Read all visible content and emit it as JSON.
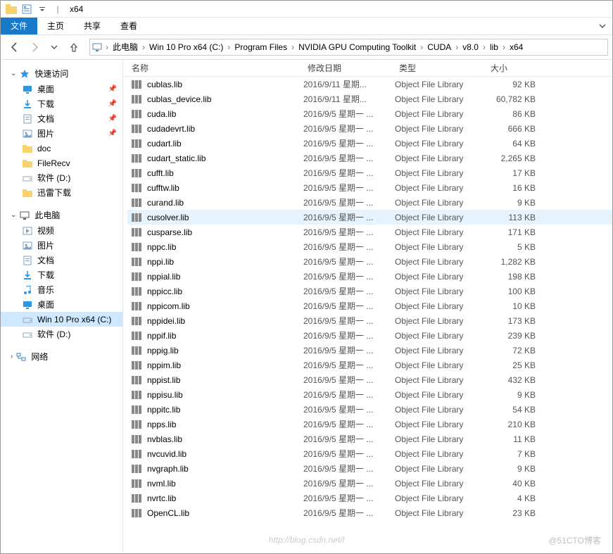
{
  "title": "x64",
  "ribbon": {
    "file": "文件",
    "home": "主页",
    "share": "共享",
    "view": "查看"
  },
  "breadcrumb": [
    "此电脑",
    "Win 10 Pro x64 (C:)",
    "Program Files",
    "NVIDIA GPU Computing Toolkit",
    "CUDA",
    "v8.0",
    "lib",
    "x64"
  ],
  "sidebar": {
    "quick": {
      "title": "快速访问",
      "items": [
        {
          "label": "桌面",
          "icon": "desktop",
          "pin": true,
          "color": "#2997e5"
        },
        {
          "label": "下载",
          "icon": "download",
          "pin": true,
          "color": "#2997e5"
        },
        {
          "label": "文档",
          "icon": "doc",
          "pin": true,
          "color": "#7aa0c4"
        },
        {
          "label": "图片",
          "icon": "picture",
          "pin": true,
          "color": "#7aa0c4"
        },
        {
          "label": "doc",
          "icon": "folder",
          "pin": false,
          "color": "#f8d36b"
        },
        {
          "label": "FileRecv",
          "icon": "folder",
          "pin": false,
          "color": "#f8d36b"
        },
        {
          "label": "软件 (D:)",
          "icon": "drive",
          "pin": false,
          "color": "#9aa7b0"
        },
        {
          "label": "迅雷下载",
          "icon": "folder",
          "pin": false,
          "color": "#f8d36b"
        }
      ]
    },
    "pc": {
      "title": "此电脑",
      "items": [
        {
          "label": "视频",
          "icon": "video",
          "color": "#7aa0c4"
        },
        {
          "label": "图片",
          "icon": "picture",
          "color": "#7aa0c4"
        },
        {
          "label": "文档",
          "icon": "doc",
          "color": "#7aa0c4"
        },
        {
          "label": "下载",
          "icon": "download",
          "color": "#2997e5"
        },
        {
          "label": "音乐",
          "icon": "music",
          "color": "#2997e5"
        },
        {
          "label": "桌面",
          "icon": "desktop",
          "color": "#2997e5"
        },
        {
          "label": "Win 10 Pro x64 (C:)",
          "icon": "drive",
          "color": "#9aa7b0",
          "selected": true
        },
        {
          "label": "软件 (D:)",
          "icon": "drive",
          "color": "#9aa7b0"
        }
      ]
    },
    "net": {
      "title": "网络"
    }
  },
  "columns": {
    "name": "名称",
    "date": "修改日期",
    "type": "类型",
    "size": "大小"
  },
  "files": [
    {
      "name": "cublas.lib",
      "date": "2016/9/11 星期...",
      "type": "Object File Library",
      "size": "92 KB"
    },
    {
      "name": "cublas_device.lib",
      "date": "2016/9/11 星期...",
      "type": "Object File Library",
      "size": "60,782 KB"
    },
    {
      "name": "cuda.lib",
      "date": "2016/9/5 星期一 ...",
      "type": "Object File Library",
      "size": "86 KB"
    },
    {
      "name": "cudadevrt.lib",
      "date": "2016/9/5 星期一 ...",
      "type": "Object File Library",
      "size": "666 KB"
    },
    {
      "name": "cudart.lib",
      "date": "2016/9/5 星期一 ...",
      "type": "Object File Library",
      "size": "64 KB"
    },
    {
      "name": "cudart_static.lib",
      "date": "2016/9/5 星期一 ...",
      "type": "Object File Library",
      "size": "2,265 KB"
    },
    {
      "name": "cufft.lib",
      "date": "2016/9/5 星期一 ...",
      "type": "Object File Library",
      "size": "17 KB"
    },
    {
      "name": "cufftw.lib",
      "date": "2016/9/5 星期一 ...",
      "type": "Object File Library",
      "size": "16 KB"
    },
    {
      "name": "curand.lib",
      "date": "2016/9/5 星期一 ...",
      "type": "Object File Library",
      "size": "9 KB"
    },
    {
      "name": "cusolver.lib",
      "date": "2016/9/5 星期一 ...",
      "type": "Object File Library",
      "size": "113 KB",
      "selected": true
    },
    {
      "name": "cusparse.lib",
      "date": "2016/9/5 星期一 ...",
      "type": "Object File Library",
      "size": "171 KB"
    },
    {
      "name": "nppc.lib",
      "date": "2016/9/5 星期一 ...",
      "type": "Object File Library",
      "size": "5 KB"
    },
    {
      "name": "nppi.lib",
      "date": "2016/9/5 星期一 ...",
      "type": "Object File Library",
      "size": "1,282 KB"
    },
    {
      "name": "nppial.lib",
      "date": "2016/9/5 星期一 ...",
      "type": "Object File Library",
      "size": "198 KB"
    },
    {
      "name": "nppicc.lib",
      "date": "2016/9/5 星期一 ...",
      "type": "Object File Library",
      "size": "100 KB"
    },
    {
      "name": "nppicom.lib",
      "date": "2016/9/5 星期一 ...",
      "type": "Object File Library",
      "size": "10 KB"
    },
    {
      "name": "nppidei.lib",
      "date": "2016/9/5 星期一 ...",
      "type": "Object File Library",
      "size": "173 KB"
    },
    {
      "name": "nppif.lib",
      "date": "2016/9/5 星期一 ...",
      "type": "Object File Library",
      "size": "239 KB"
    },
    {
      "name": "nppig.lib",
      "date": "2016/9/5 星期一 ...",
      "type": "Object File Library",
      "size": "72 KB"
    },
    {
      "name": "nppim.lib",
      "date": "2016/9/5 星期一 ...",
      "type": "Object File Library",
      "size": "25 KB"
    },
    {
      "name": "nppist.lib",
      "date": "2016/9/5 星期一 ...",
      "type": "Object File Library",
      "size": "432 KB"
    },
    {
      "name": "nppisu.lib",
      "date": "2016/9/5 星期一 ...",
      "type": "Object File Library",
      "size": "9 KB"
    },
    {
      "name": "nppitc.lib",
      "date": "2016/9/5 星期一 ...",
      "type": "Object File Library",
      "size": "54 KB"
    },
    {
      "name": "npps.lib",
      "date": "2016/9/5 星期一 ...",
      "type": "Object File Library",
      "size": "210 KB"
    },
    {
      "name": "nvblas.lib",
      "date": "2016/9/5 星期一 ...",
      "type": "Object File Library",
      "size": "11 KB"
    },
    {
      "name": "nvcuvid.lib",
      "date": "2016/9/5 星期一 ...",
      "type": "Object File Library",
      "size": "7 KB"
    },
    {
      "name": "nvgraph.lib",
      "date": "2016/9/5 星期一 ...",
      "type": "Object File Library",
      "size": "9 KB"
    },
    {
      "name": "nvml.lib",
      "date": "2016/9/5 星期一 ...",
      "type": "Object File Library",
      "size": "40 KB"
    },
    {
      "name": "nvrtc.lib",
      "date": "2016/9/5 星期一 ...",
      "type": "Object File Library",
      "size": "4 KB"
    },
    {
      "name": "OpenCL.lib",
      "date": "2016/9/5 星期一 ...",
      "type": "Object File Library",
      "size": "23 KB"
    }
  ],
  "watermark": {
    "url": "http://blog.csdn.net/l",
    "right": "@51CTO博客"
  }
}
